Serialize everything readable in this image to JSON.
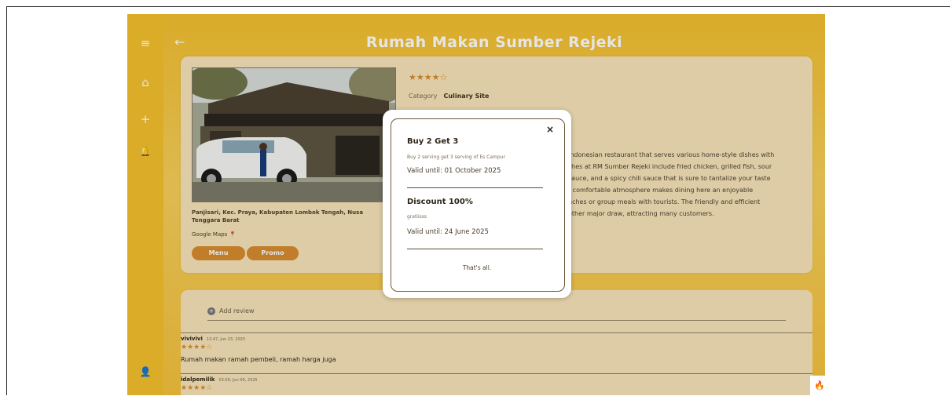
{
  "page": {
    "title": "Rumah Makan Sumber Rejeki",
    "back_icon": "←"
  },
  "sidebar": {
    "menu_icon": "≡",
    "home_icon": "⌂",
    "add_icon": "+",
    "bell_icon": "🔔",
    "user_icon": "👤"
  },
  "detail": {
    "rating": "★★★★☆",
    "category_label": "Category",
    "category_value": "Culinary Site",
    "address": "Panjisari, Kec. Praya, Kabupaten Lombok Tengah, Nusa Tenggara Barat",
    "google_maps": "Google Maps",
    "menu_button": "Menu",
    "promo_button": "Promo",
    "description_lines": [
      "Indonesian restaurant that serves various home-style dishes with",
      "shes at RM Sumber Rejeki include fried chicken, grilled fish, sour",
      "sauce, and a spicy chili sauce that is sure to tantalize your taste",
      "t comfortable atmosphere makes dining here an enjoyable",
      "nches or group meals with tourists. The friendly and efficient",
      "other major draw, attracting many customers."
    ]
  },
  "reviews": {
    "add_review": "Add review",
    "items": [
      {
        "name": "vivivivi",
        "date": "13.47, Jun 23, 2025",
        "stars": "★★★★☆",
        "text": "Rumah makan ramah pembeli, ramah harga juga"
      },
      {
        "name": "idalpemilik",
        "date": "03.09, Jun 09, 2025",
        "stars": "★★★★☆",
        "text": ""
      }
    ]
  },
  "promo_modal": {
    "close_icon": "×",
    "promos": [
      {
        "title": "Buy 2 Get 3",
        "description": "Buy 2 serving get 3 serving of Es Campur",
        "valid": "Valid until: 01 October 2025"
      },
      {
        "title": "Discount 100%",
        "description": "gratiisss",
        "valid": "Valid until: 24 June 2025"
      }
    ],
    "end_text": "That's all."
  },
  "corner_icon": "🔥",
  "colors": {
    "accent": "#f3bf2f",
    "button": "#d78c2e",
    "card": "#f7e4b8"
  }
}
